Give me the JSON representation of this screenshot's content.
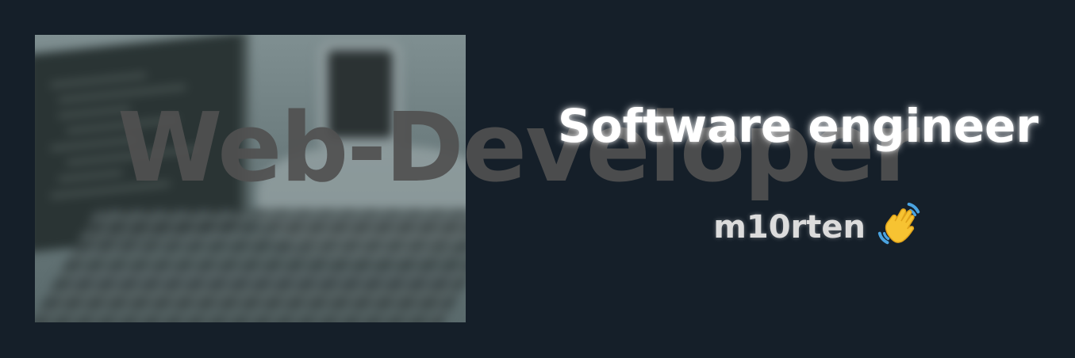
{
  "banner": {
    "background_word": "Web-Developer",
    "title": "Software engineer",
    "subtitle": "m10rten",
    "emoji_icon": "waving-hand-icon"
  },
  "colors": {
    "background": "#151f29",
    "title": "#ffffff",
    "subtitle": "#dcdcdc",
    "background_word": "#505050",
    "wave_yellow": "#f7c332",
    "wave_blue": "#4aa3e0"
  }
}
